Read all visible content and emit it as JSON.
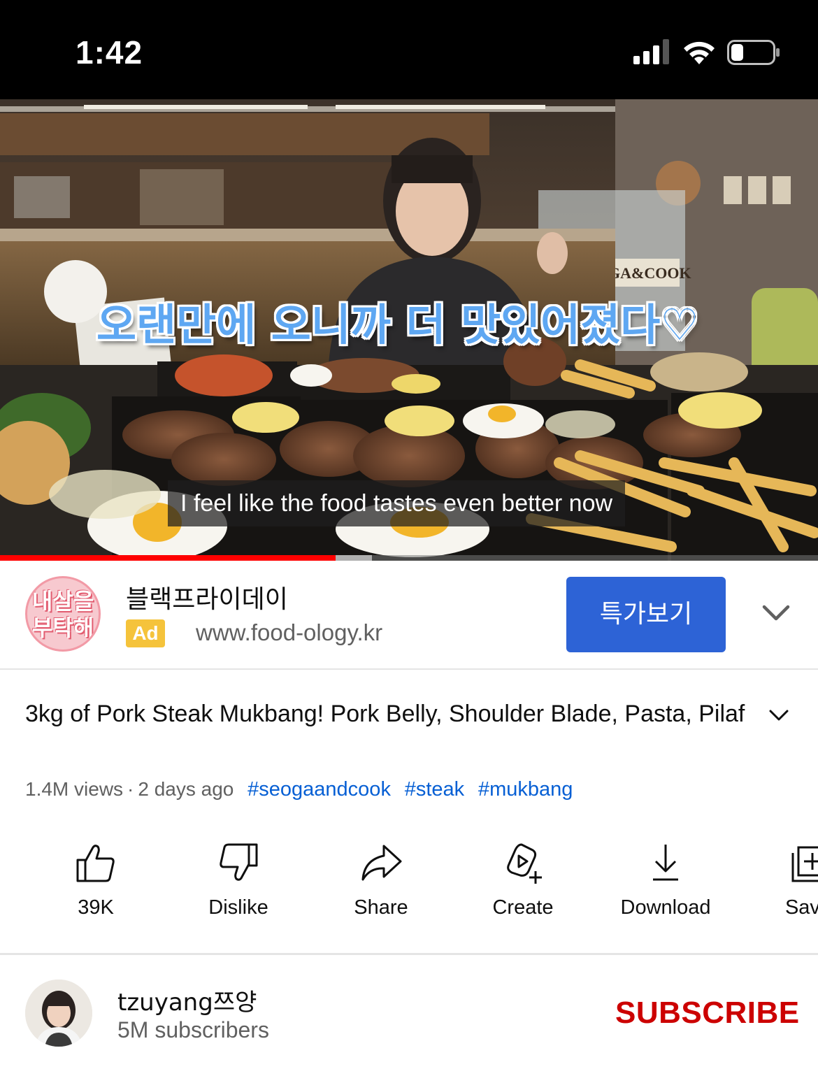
{
  "status_bar": {
    "time": "1:42"
  },
  "video": {
    "overlay_text": "오랜만에 오니까 더 맛있어졌다♡",
    "caption": "I feel like the food tastes even better now",
    "progress_played": 0.41,
    "progress_buffered": 0.455,
    "store_sign": "SEOGA&COOK"
  },
  "ad": {
    "logo_text_line1": "내살을",
    "logo_text_line2": "부탁해",
    "title": "블랙프라이데이",
    "badge": "Ad",
    "url": "www.food-ology.kr",
    "cta_label": "특가보기"
  },
  "title": "3kg of Pork Steak Mukbang! Pork Belly, Shoulder Blade, Pasta, Pilaf",
  "meta": {
    "views": "1.4M views",
    "separator": "·",
    "age": "2 days ago",
    "hashtags": [
      "#seogaandcook",
      "#steak",
      "#mukbang"
    ]
  },
  "actions": [
    {
      "label": "39K",
      "icon": "thumbs-up-icon"
    },
    {
      "label": "Dislike",
      "icon": "thumbs-down-icon"
    },
    {
      "label": "Share",
      "icon": "share-icon"
    },
    {
      "label": "Create",
      "icon": "create-icon"
    },
    {
      "label": "Download",
      "icon": "download-icon"
    },
    {
      "label": "Save",
      "icon": "save-icon"
    }
  ],
  "channel": {
    "name": "tzuyang쯔양",
    "subscribers": "5M subscribers",
    "subscribe_label": "SUBSCRIBE"
  },
  "colors": {
    "progress": "#ff0000",
    "cta": "#2d63d6",
    "hashtag": "#065fd4",
    "subscribe": "#cc0000",
    "ad_badge": "#f5c33b"
  }
}
